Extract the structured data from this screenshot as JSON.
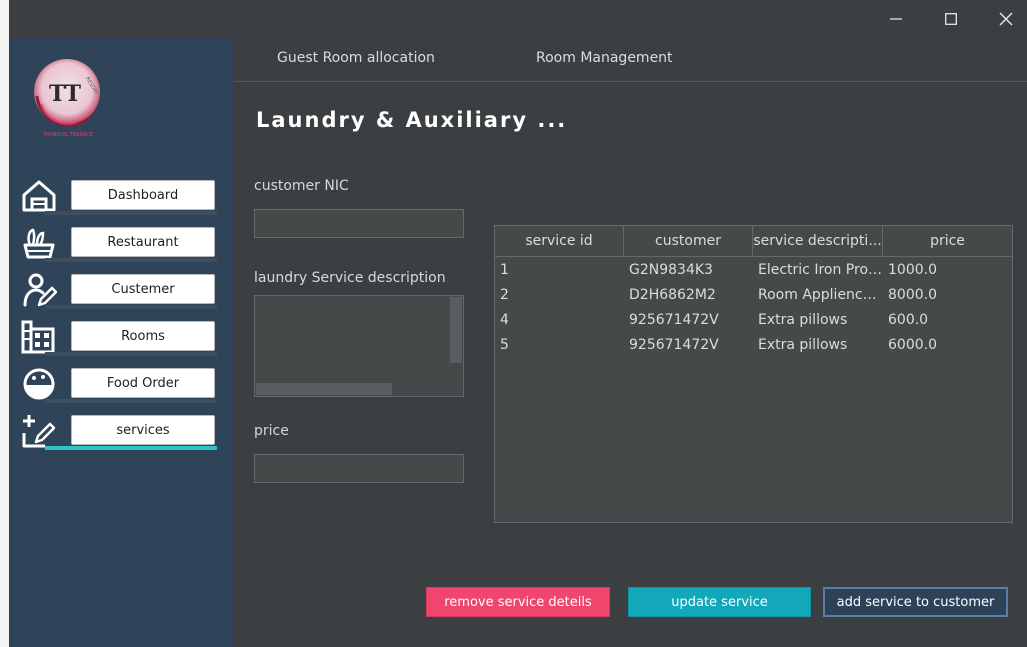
{
  "window": {
    "controls": [
      "minimize-icon",
      "maximize-icon",
      "close-icon"
    ]
  },
  "logo": {
    "monogram": "TT",
    "arc_text": "RESORT",
    "caption": "TRANQUIL TERRACE",
    "accent": "#d9436f"
  },
  "sidebar": {
    "items": [
      {
        "label": "Dashboard",
        "icon": "home-icon"
      },
      {
        "label": "Restaurant",
        "icon": "restaurant-icon"
      },
      {
        "label": "Custemer",
        "icon": "customer-icon"
      },
      {
        "label": "Rooms",
        "icon": "rooms-icon"
      },
      {
        "label": "Food Order",
        "icon": "food-order-icon"
      },
      {
        "label": "services",
        "icon": "services-icon",
        "active": true
      }
    ]
  },
  "tabs": [
    {
      "label": "Guest Room allocation"
    },
    {
      "label": "Room Management"
    }
  ],
  "page": {
    "title": "Laundry  &  Auxiliary  ..."
  },
  "form": {
    "nic_label": "customer NIC",
    "nic_value": "",
    "description_label": "laundry Service description",
    "description_value": "",
    "price_label": "price",
    "price_value": ""
  },
  "table": {
    "columns": [
      "service id",
      "customer",
      "service descripti...",
      "price"
    ],
    "rows": [
      [
        "1",
        "G2N9834K3",
        "Electric Iron Prov...",
        "1000.0"
      ],
      [
        "2",
        "D2H6862M2",
        "Room Applience...",
        "8000.0"
      ],
      [
        "4",
        "925671472V",
        "Extra pillows",
        "600.0"
      ],
      [
        "5",
        "925671472V",
        "Extra pillows",
        "6000.0"
      ]
    ]
  },
  "actions": {
    "remove_label": "remove  service deteils",
    "update_label": "update service",
    "add_label": "add service to customer"
  },
  "colors": {
    "remove": "#f0456c",
    "update": "#13a8b9",
    "add": "#2e4257",
    "active_indicator": "#2bc3c8"
  }
}
